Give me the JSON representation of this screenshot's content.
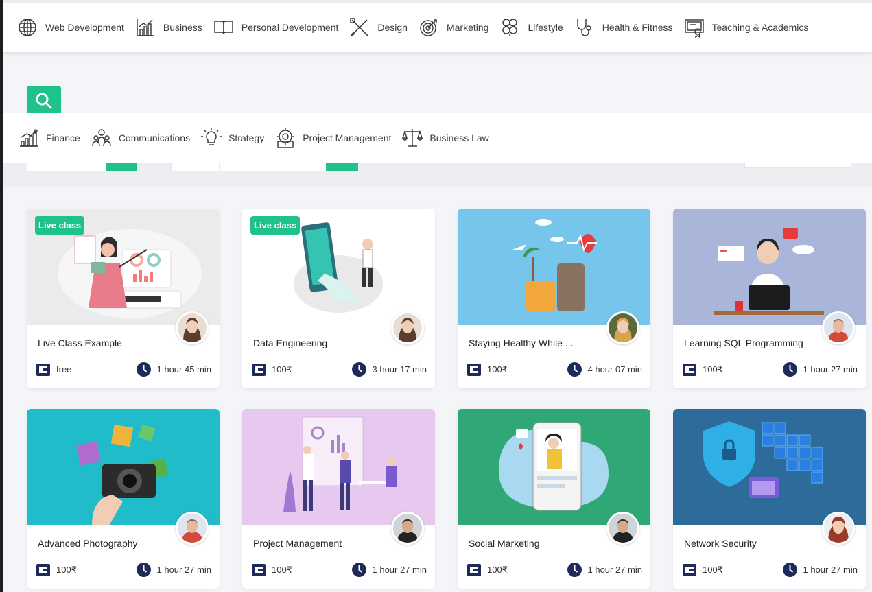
{
  "categories": [
    {
      "label": "Web Development",
      "icon": "globe-icon"
    },
    {
      "label": "Business",
      "icon": "bar-chart-icon"
    },
    {
      "label": "Personal Development",
      "icon": "book-icon"
    },
    {
      "label": "Design",
      "icon": "design-tools-icon"
    },
    {
      "label": "Marketing",
      "icon": "target-icon"
    },
    {
      "label": "Lifestyle",
      "icon": "lifestyle-icon"
    },
    {
      "label": "Health & Fitness",
      "icon": "stethoscope-icon"
    },
    {
      "label": "Teaching & Academics",
      "icon": "certificate-icon"
    }
  ],
  "subcategories": [
    {
      "label": "Finance",
      "icon": "finance-chart-icon"
    },
    {
      "label": "Communications",
      "icon": "people-icon"
    },
    {
      "label": "Strategy",
      "icon": "lightbulb-icon"
    },
    {
      "label": "Project Management",
      "icon": "gear-building-icon"
    },
    {
      "label": "Business Law",
      "icon": "scales-icon"
    }
  ],
  "search": {
    "icon": "search-icon"
  },
  "courses": [
    {
      "title": "Live Class Example",
      "badge": "Live class",
      "price": "free",
      "duration": "1 hour 45 min"
    },
    {
      "title": "Data Engineering",
      "badge": "Live class",
      "price": "100₹",
      "duration": "3 hour 17 min"
    },
    {
      "title": "Staying Healthy While ...",
      "badge": "",
      "price": "100₹",
      "duration": "4 hour 07 min"
    },
    {
      "title": "Learning SQL Programming",
      "badge": "",
      "price": "100₹",
      "duration": "1 hour 27 min"
    },
    {
      "title": "Advanced Photography",
      "badge": "",
      "price": "100₹",
      "duration": "1 hour 27 min"
    },
    {
      "title": "Project Management",
      "badge": "",
      "price": "100₹",
      "duration": "1 hour 27 min"
    },
    {
      "title": "Social Marketing",
      "badge": "",
      "price": "100₹",
      "duration": "1 hour 27 min"
    },
    {
      "title": "Network Security",
      "badge": "",
      "price": "100₹",
      "duration": "1 hour 27 min"
    }
  ],
  "colors": {
    "accent": "#1fc28a",
    "icon_dark": "#1e2a5a",
    "page_bg": "#f3f5f8"
  }
}
